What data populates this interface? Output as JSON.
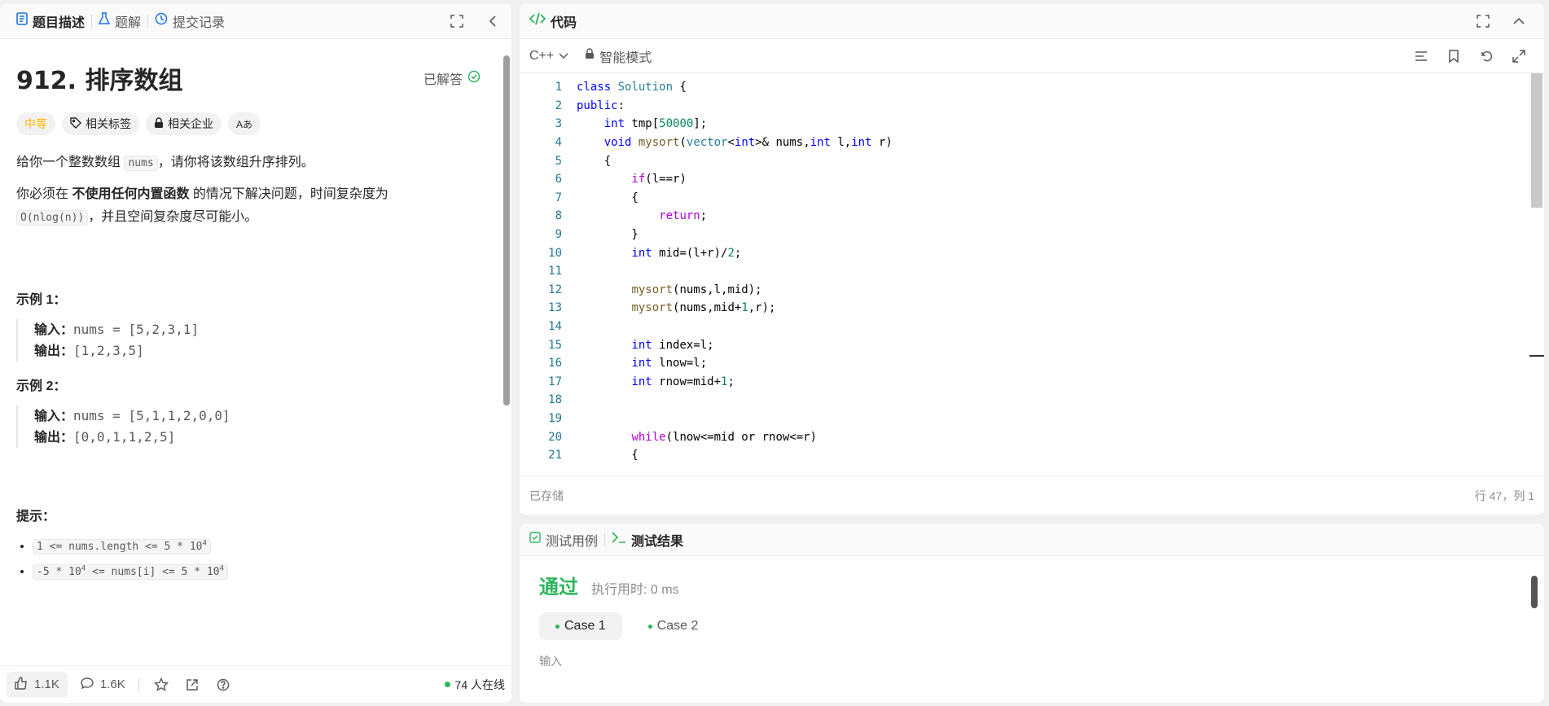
{
  "left": {
    "tabs": [
      {
        "label": "题目描述",
        "icon": "document-icon"
      },
      {
        "label": "题解",
        "icon": "flask-icon"
      },
      {
        "label": "提交记录",
        "icon": "history-icon"
      }
    ],
    "title": "912. 排序数组",
    "solved_label": "已解答",
    "difficulty": "中等",
    "tag_label": "相关标签",
    "company_label": "相关企业",
    "font_toggle": "Aあ",
    "desc1_before": "给你一个整数数组 ",
    "desc1_code": "nums",
    "desc1_after": "，请你将该数组升序排列。",
    "desc2_before": "你必须在 ",
    "desc2_bold": "不使用任何内置函数",
    "desc2_after": " 的情况下解决问题，时间复杂度为",
    "desc2_code": "O(nlog(n))",
    "desc2_tail": "，并且空间复杂度尽可能小。",
    "example1_title": "示例 1：",
    "example1_input_label": "输入：",
    "example1_input": "nums = [5,2,3,1]",
    "example1_output_label": "输出：",
    "example1_output": "[1,2,3,5]",
    "example2_title": "示例 2：",
    "example2_input_label": "输入：",
    "example2_input": "nums = [5,1,1,2,0,0]",
    "example2_output_label": "输出：",
    "example2_output": "[0,0,1,1,2,5]",
    "hint_title": "提示：",
    "hint1_a": "1 <= nums.length <= 5 * 10",
    "hint1_sup": "4",
    "hint2_a": "-5 * 10",
    "hint2_sup1": "4",
    "hint2_b": " <= nums[i] <= 5 * 10",
    "hint2_sup2": "4",
    "likes": "1.1K",
    "comments": "1.6K",
    "online": "74 人在线"
  },
  "editor": {
    "title": "代码",
    "language": "C++",
    "mode": "智能模式",
    "saved": "已存储",
    "cursor": "行 47，列 1"
  },
  "results": {
    "tab1": "测试用例",
    "tab2": "测试结果",
    "status": "通过",
    "runtime": "执行用时: 0 ms",
    "case1": "Case 1",
    "case2": "Case 2",
    "input_label": "输入"
  },
  "colors": {
    "accent_green": "#2db55d",
    "difficulty": "#ffb800"
  }
}
